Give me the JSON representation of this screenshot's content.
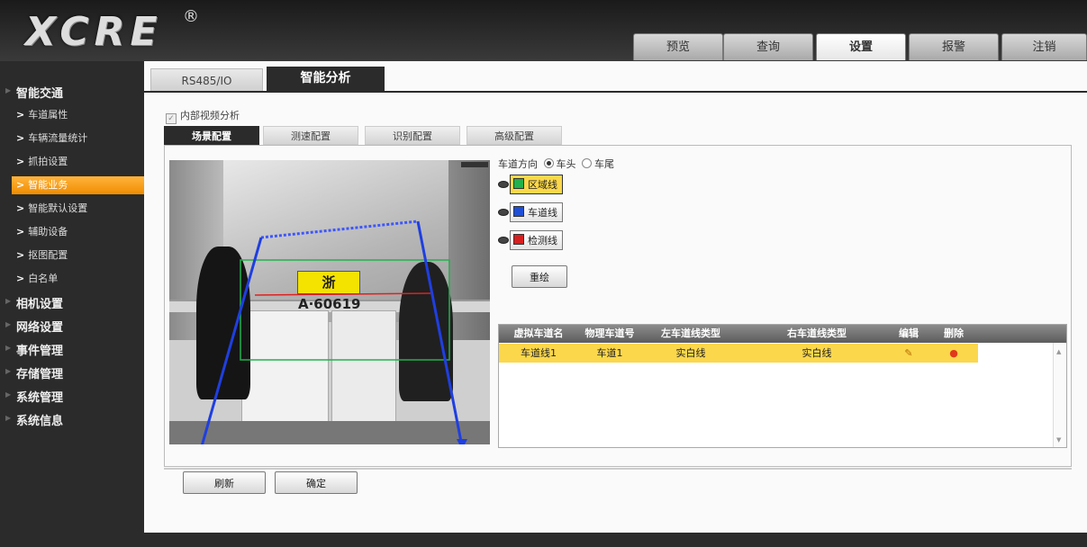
{
  "brand": {
    "logo": "XCRE",
    "reg_mark": "®"
  },
  "nav": {
    "tabs": [
      {
        "label": "预览",
        "active": false
      },
      {
        "label": "查询",
        "active": false
      },
      {
        "label": "设置",
        "active": true
      },
      {
        "label": "报警",
        "active": false
      },
      {
        "label": "注销",
        "active": false
      }
    ]
  },
  "sidebar": {
    "group_main": "智能交通",
    "items": [
      {
        "label": "车道属性",
        "active": false
      },
      {
        "label": "车辆流量统计",
        "active": false
      },
      {
        "label": "抓拍设置",
        "active": false
      },
      {
        "label": "智能业务",
        "active": true
      },
      {
        "label": "智能默认设置",
        "active": false
      },
      {
        "label": "辅助设备",
        "active": false
      },
      {
        "label": "抠图配置",
        "active": false
      },
      {
        "label": "白名单",
        "active": false
      }
    ],
    "groups": [
      "相机设置",
      "网络设置",
      "事件管理",
      "存储管理",
      "系统管理",
      "系统信息"
    ],
    "item_arrow": ">"
  },
  "page_tabs": {
    "tab1": "RS485/IO",
    "tab2": "智能分析",
    "active": "智能分析"
  },
  "internal_video_analysis": {
    "label": "内部视频分析",
    "checked": true,
    "check_mark": "✓"
  },
  "sub_tabs": [
    {
      "label": "场景配置",
      "active": true
    },
    {
      "label": "测速配置",
      "active": false
    },
    {
      "label": "识别配置",
      "active": false
    },
    {
      "label": "高级配置",
      "active": false
    }
  ],
  "video": {
    "plate_text": "浙A·60619"
  },
  "lane_direction": {
    "label": "车道方向",
    "option_head": "车头",
    "option_tail": "车尾",
    "selected": "车头"
  },
  "line_buttons": [
    {
      "label": "区域线",
      "color": "#22b14c",
      "active": true
    },
    {
      "label": "车道线",
      "color": "#1f4fd6",
      "active": false
    },
    {
      "label": "检测线",
      "color": "#d62020",
      "active": false
    }
  ],
  "redraw_button": "重绘",
  "lane_table": {
    "headers": [
      "虚拟车道名",
      "物理车道号",
      "左车道线类型",
      "右车道线类型",
      "编辑",
      "删除"
    ],
    "rows": [
      {
        "virtual_lane": "车道线1",
        "physical_lane": "车道1",
        "left_type": "实白线",
        "right_type": "实白线",
        "edit_icon": "✎",
        "delete_icon": "●"
      }
    ],
    "scroll_up": "▲",
    "scroll_down": "▼"
  },
  "bottom_buttons": {
    "refresh": "刷新",
    "confirm": "确定"
  },
  "colors": {
    "accent_orange": "#f08c00",
    "selected_row": "#fbd74b",
    "zone_line": "#22b14c",
    "lane_line": "#1f3fe0",
    "detect_line": "#e02020"
  }
}
